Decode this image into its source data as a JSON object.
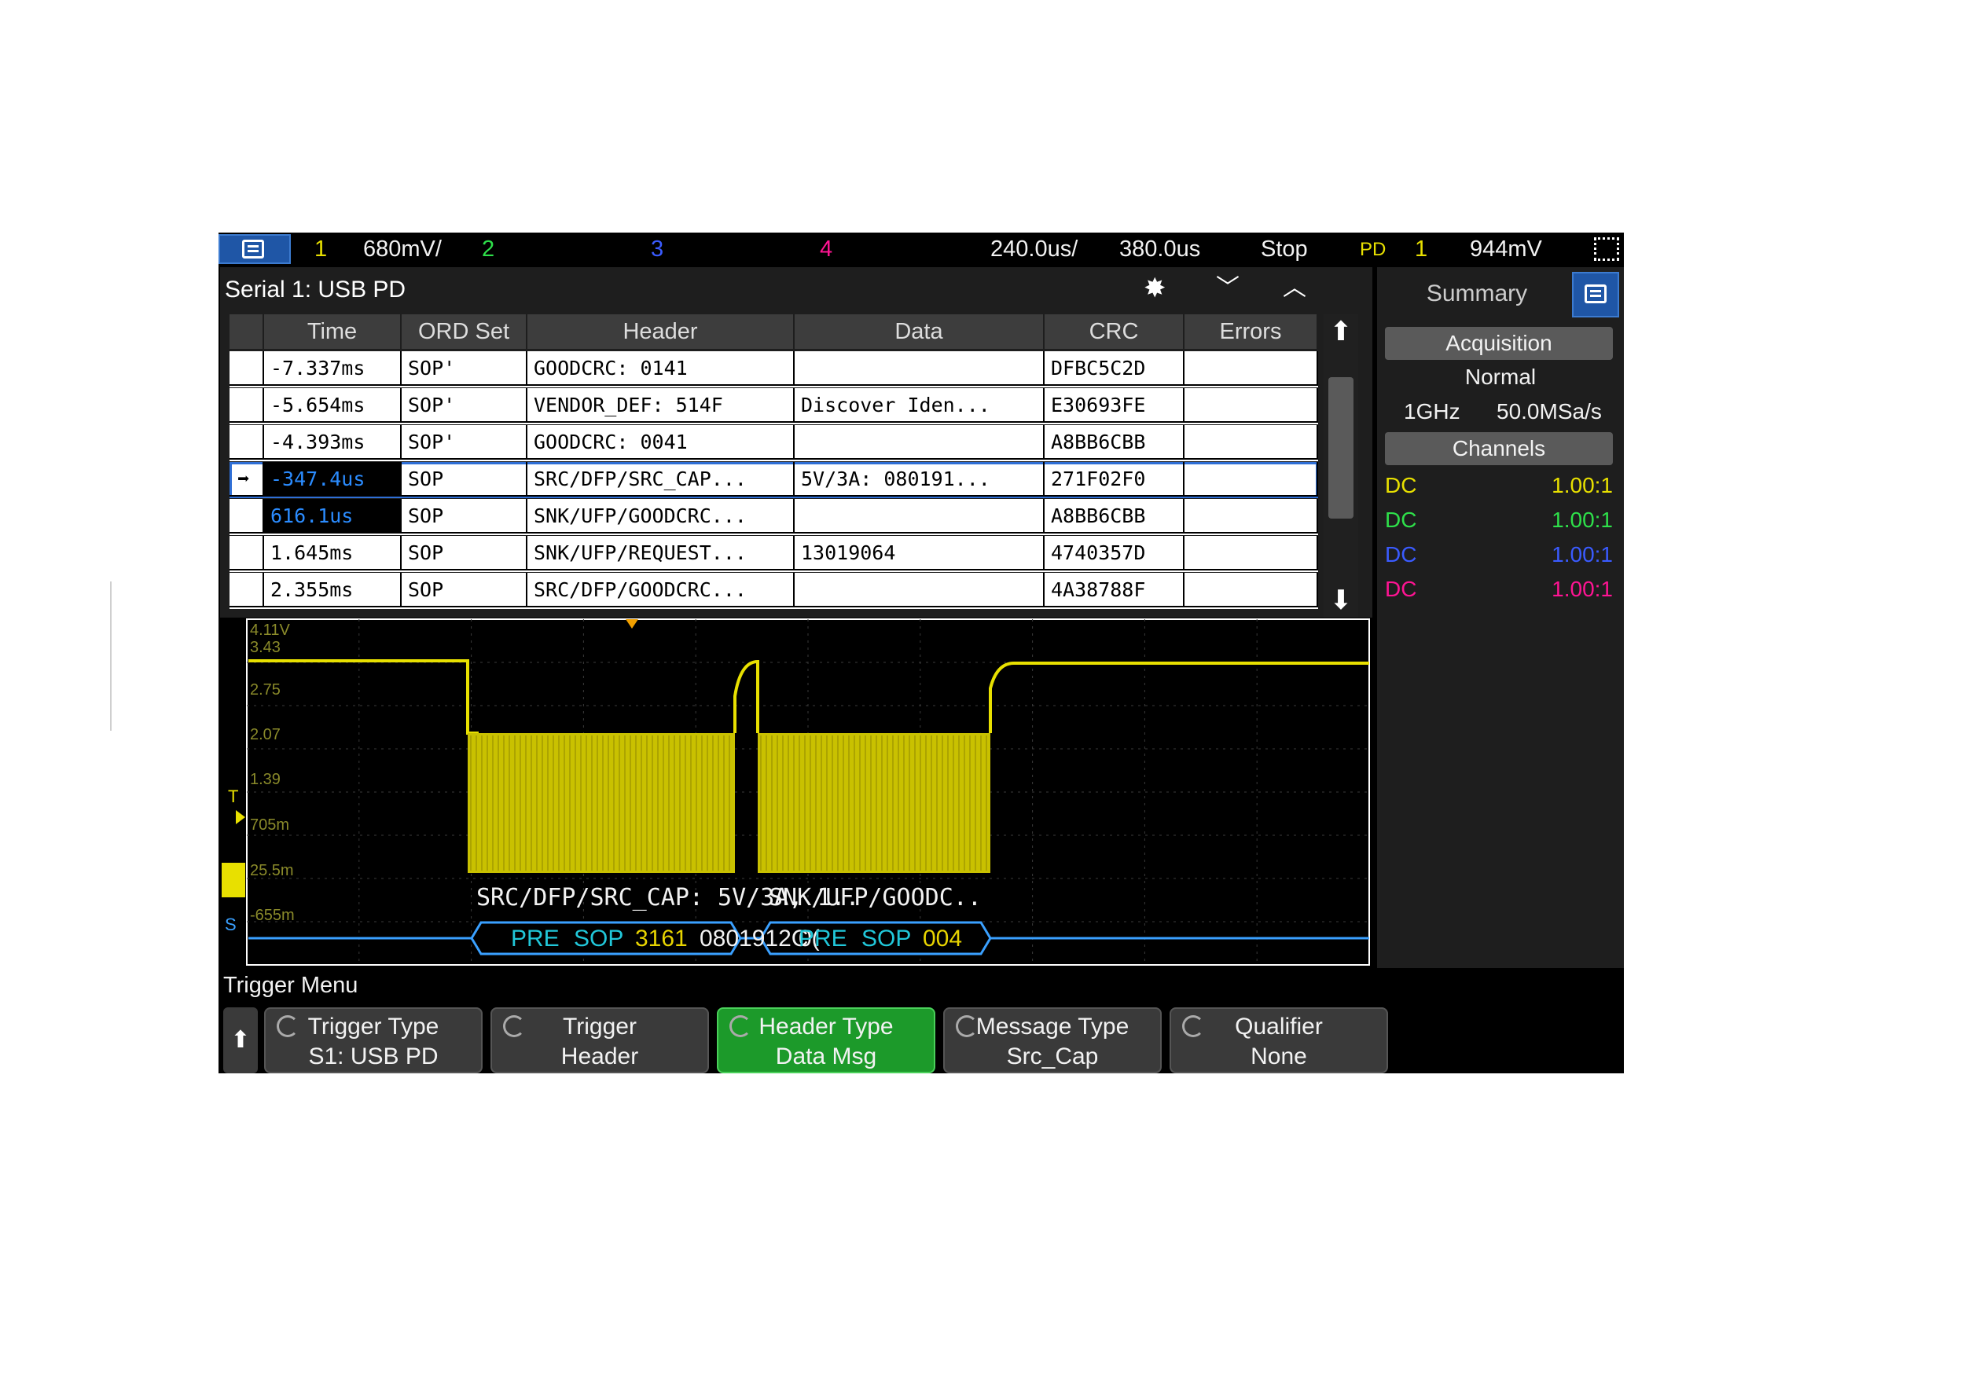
{
  "topbar": {
    "ch1_num": "1",
    "ch1_scale": "680mV/",
    "ch2_num": "2",
    "ch3_num": "3",
    "ch4_num": "4",
    "timebase": "240.0us/",
    "delay": "380.0us",
    "run_state": "Stop",
    "trig_src_label": "PD",
    "trig_ch": "1",
    "trig_level": "944mV"
  },
  "panel": {
    "title": "Serial 1: USB PD",
    "columns": [
      "Time",
      "ORD Set",
      "Header",
      "Data",
      "CRC",
      "Errors"
    ],
    "rows": [
      {
        "time": "-7.337ms",
        "ord": "SOP'",
        "header": "GOODCRC: 0141",
        "data": "",
        "crc": "DFBC5C2D",
        "errors": ""
      },
      {
        "time": "-5.654ms",
        "ord": "SOP'",
        "header": "VENDOR_DEF: 514F",
        "data": "Discover Iden...",
        "crc": "E30693FE",
        "errors": ""
      },
      {
        "time": "-4.393ms",
        "ord": "SOP'",
        "header": "GOODCRC: 0041",
        "data": "",
        "crc": "A8BB6CBB",
        "errors": ""
      },
      {
        "time": "-347.4us",
        "ord": "SOP",
        "header": "SRC/DFP/SRC_CAP...",
        "data": "5V/3A: 080191...",
        "crc": "271F02F0",
        "errors": ""
      },
      {
        "time": "616.1us",
        "ord": "SOP",
        "header": "SNK/UFP/GOODCRC...",
        "data": "",
        "crc": "A8BB6CBB",
        "errors": ""
      },
      {
        "time": "1.645ms",
        "ord": "SOP",
        "header": "SNK/UFP/REQUEST...",
        "data": "13019064",
        "crc": "4740357D",
        "errors": ""
      },
      {
        "time": "2.355ms",
        "ord": "SOP",
        "header": "SRC/DFP/GOODCRC...",
        "data": "",
        "crc": "4A38788F",
        "errors": ""
      }
    ]
  },
  "side": {
    "tab": "Summary",
    "acq_header": "Acquisition",
    "acq_mode": "Normal",
    "bandwidth": "1GHz",
    "sample_rate": "50.0MSa/s",
    "channels_header": "Channels",
    "channels": [
      {
        "coupling": "DC",
        "probe": "1.00:1",
        "color": "#e8e000"
      },
      {
        "coupling": "DC",
        "probe": "1.00:1",
        "color": "#2ee04a"
      },
      {
        "coupling": "DC",
        "probe": "1.00:1",
        "color": "#3a5bff"
      },
      {
        "coupling": "DC",
        "probe": "1.00:1",
        "color": "#ff1493"
      }
    ]
  },
  "wave": {
    "voltage_ticks": [
      "4.11V",
      "3.43",
      "2.75",
      "2.07",
      "1.39",
      "705m",
      "25.5m",
      "-655m"
    ],
    "decode1_label": "SRC/DFP/SRC_CAP: 5V/3A, 1..",
    "decode2_label": "SNK/UFP/GOODC..",
    "bus1_pre": "PRE",
    "bus1_sop": "SOP",
    "bus1_hdr": "3161",
    "bus1_data": "0801912C",
    "bus1_more": "0(",
    "bus2_pre": "PRE",
    "bus2_sop": "SOP",
    "bus2_hdr": "004",
    "trig_marker": "T"
  },
  "trigger": {
    "title": "Trigger Menu",
    "keys": [
      {
        "line1": "Trigger Type",
        "line2": "S1: USB PD"
      },
      {
        "line1": "Trigger",
        "line2": "Header"
      },
      {
        "line1": "Header Type",
        "line2": "Data Msg"
      },
      {
        "line1": "Message Type",
        "line2": "Src_Cap"
      },
      {
        "line1": "Qualifier",
        "line2": "None"
      }
    ]
  },
  "colors": {
    "ch1": "#e8e000",
    "ch2": "#2ee04a",
    "ch3": "#3a5bff",
    "ch4": "#ff1493",
    "decode_blue": "#3aa0ff",
    "active_key": "#1c9a2a"
  }
}
